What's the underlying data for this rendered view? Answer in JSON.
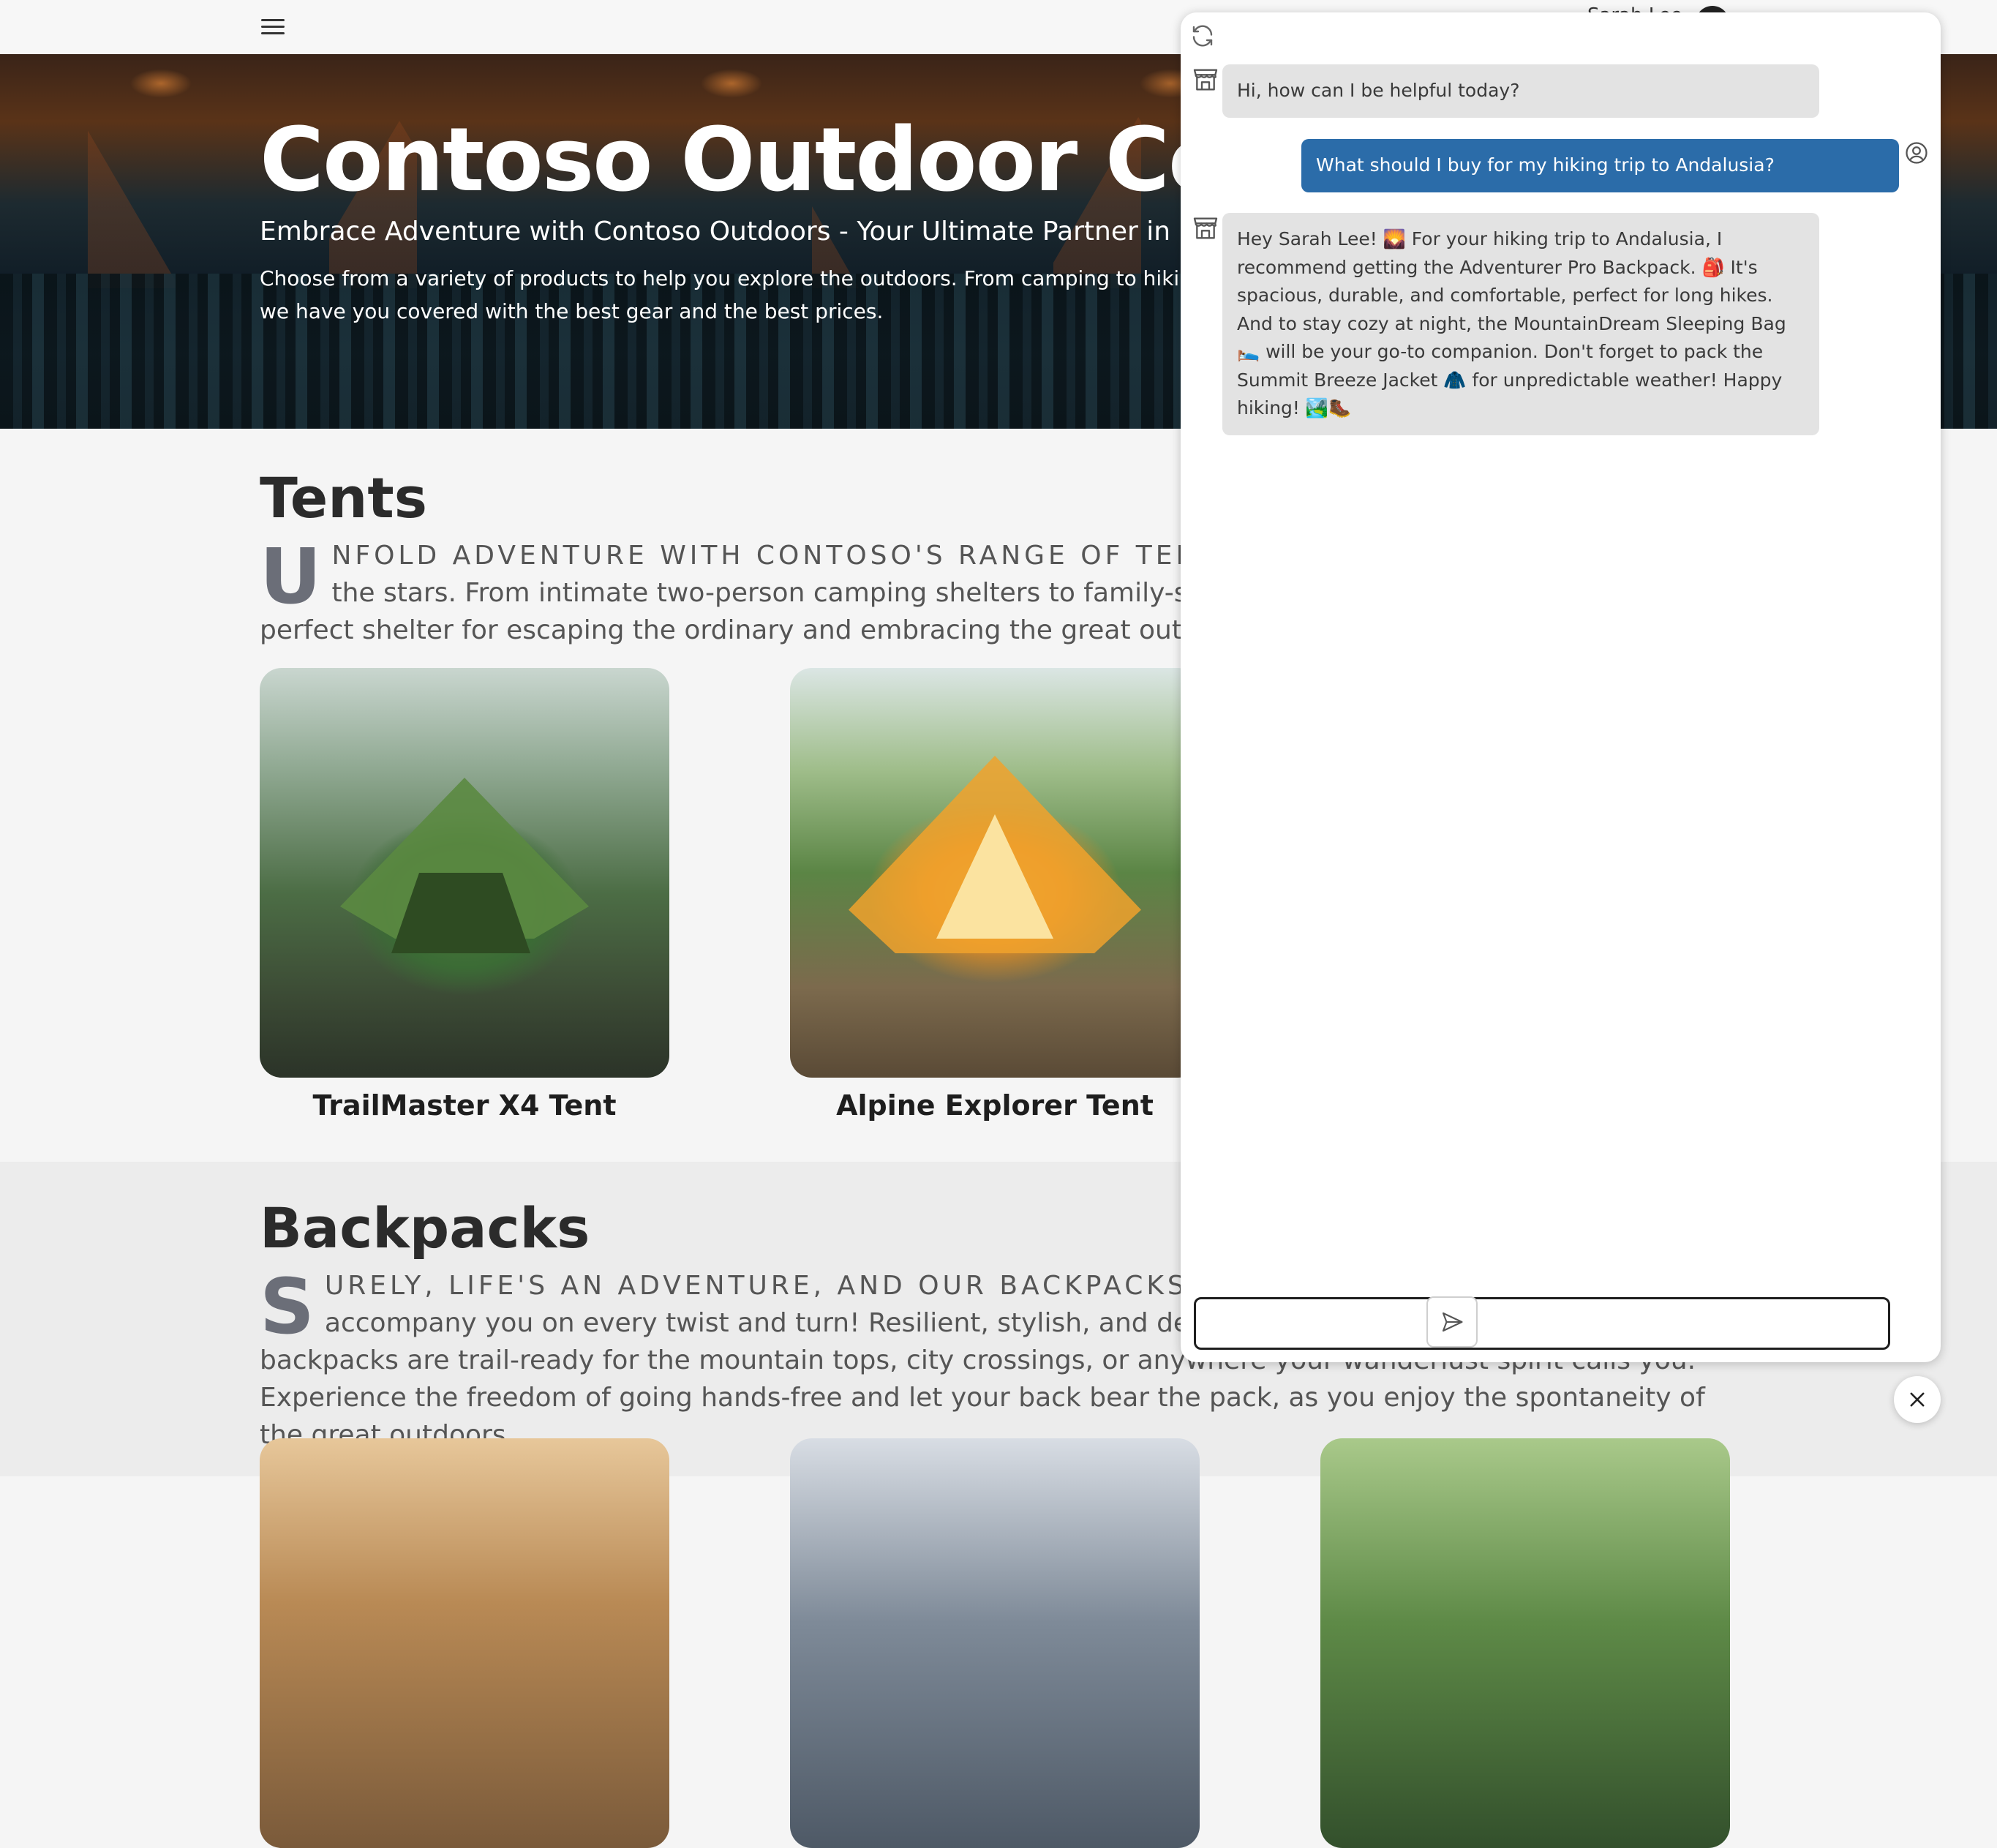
{
  "nav": {
    "menu_icon": "hamburger-menu-icon",
    "username": "Sarah Lee",
    "avatar_icon": "user-avatar"
  },
  "hero": {
    "title": "Contoso Outdoor Company",
    "subtitle": "Embrace Adventure with Contoso Outdoors - Your Ultimate Partner in Exploring the Great Outdoors!",
    "description": "Choose from a variety of products to help you explore the outdoors. From camping to hiking, we have you covered with the best gear and the best prices."
  },
  "tents": {
    "heading": "Tents",
    "dropcap": "U",
    "intro_lead": "nfold adventure with Contoso's range of tents",
    "intro_rest": " the stars. From intimate two-person camping shelters to family-sized camping tents, we've got the perfect shelter for escaping the ordinary and embracing the great outdoors.",
    "products": [
      {
        "name": "TrailMaster X4 Tent"
      },
      {
        "name": "Alpine Explorer Tent"
      }
    ]
  },
  "backpacks": {
    "heading": "Backpacks",
    "dropcap": "S",
    "intro_lead": "urely, life's an adventure, and our backpacks cat",
    "intro_rest": "accompany you on every twist and turn! Resilient, stylish, and designed with you in mind, our backpacks are trail-ready for the mountain tops, city crossings, or anywhere your wanderlust spirit calls you. Experience the freedom of going hands-free and let your back bear the pack, as you enjoy the spontaneity of the great outdoors."
  },
  "chat": {
    "refresh_icon": "refresh-icon",
    "messages": [
      {
        "role": "assistant",
        "text": "Hi, how can I be helpful today?"
      },
      {
        "role": "user",
        "text": "What should I buy for my hiking trip to Andalusia?"
      },
      {
        "role": "assistant",
        "text": "Hey Sarah Lee! 🌄 For your hiking trip to Andalusia, I recommend getting the Adventurer Pro Backpack. 🎒 It's spacious, durable, and comfortable, perfect for long hikes. And to stay cozy at night, the MountainDream Sleeping Bag 🛌 will be your go-to companion. Don't forget to pack the Summit Breeze Jacket 🧥 for unpredictable weather! Happy hiking! 🏞️🥾"
      }
    ],
    "input_value": "",
    "send_icon": "send-icon",
    "close_icon": "close-icon"
  }
}
